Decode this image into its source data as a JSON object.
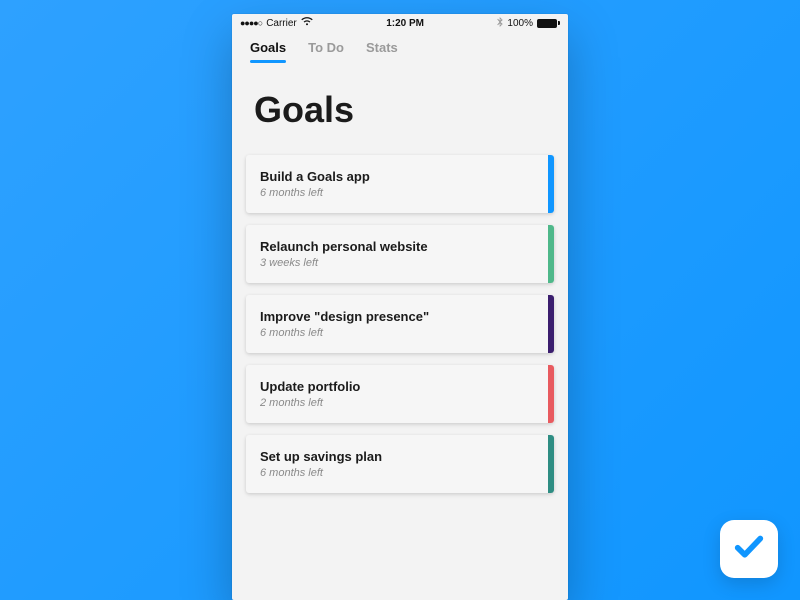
{
  "status": {
    "carrier": "Carrier",
    "time": "1:20 PM",
    "battery_pct": "100%"
  },
  "tabs": [
    {
      "label": "Goals",
      "active": true
    },
    {
      "label": "To Do",
      "active": false
    },
    {
      "label": "Stats",
      "active": false
    }
  ],
  "page_title": "Goals",
  "goals": [
    {
      "title": "Build a Goals app",
      "meta": "6 months left",
      "accent": "#1096ff"
    },
    {
      "title": "Relaunch personal website",
      "meta": "3 weeks left",
      "accent": "#4fb88a"
    },
    {
      "title": "Improve \"design presence\"",
      "meta": "6 months left",
      "accent": "#3b1e6e"
    },
    {
      "title": "Update portfolio",
      "meta": "2 months left",
      "accent": "#e85a5f"
    },
    {
      "title": "Set up savings plan",
      "meta": "6 months left",
      "accent": "#2e8d83"
    }
  ],
  "colors": {
    "bg_gradient_from": "#2ea1ff",
    "bg_gradient_to": "#1096ff",
    "tab_underline": "#1096ff"
  }
}
